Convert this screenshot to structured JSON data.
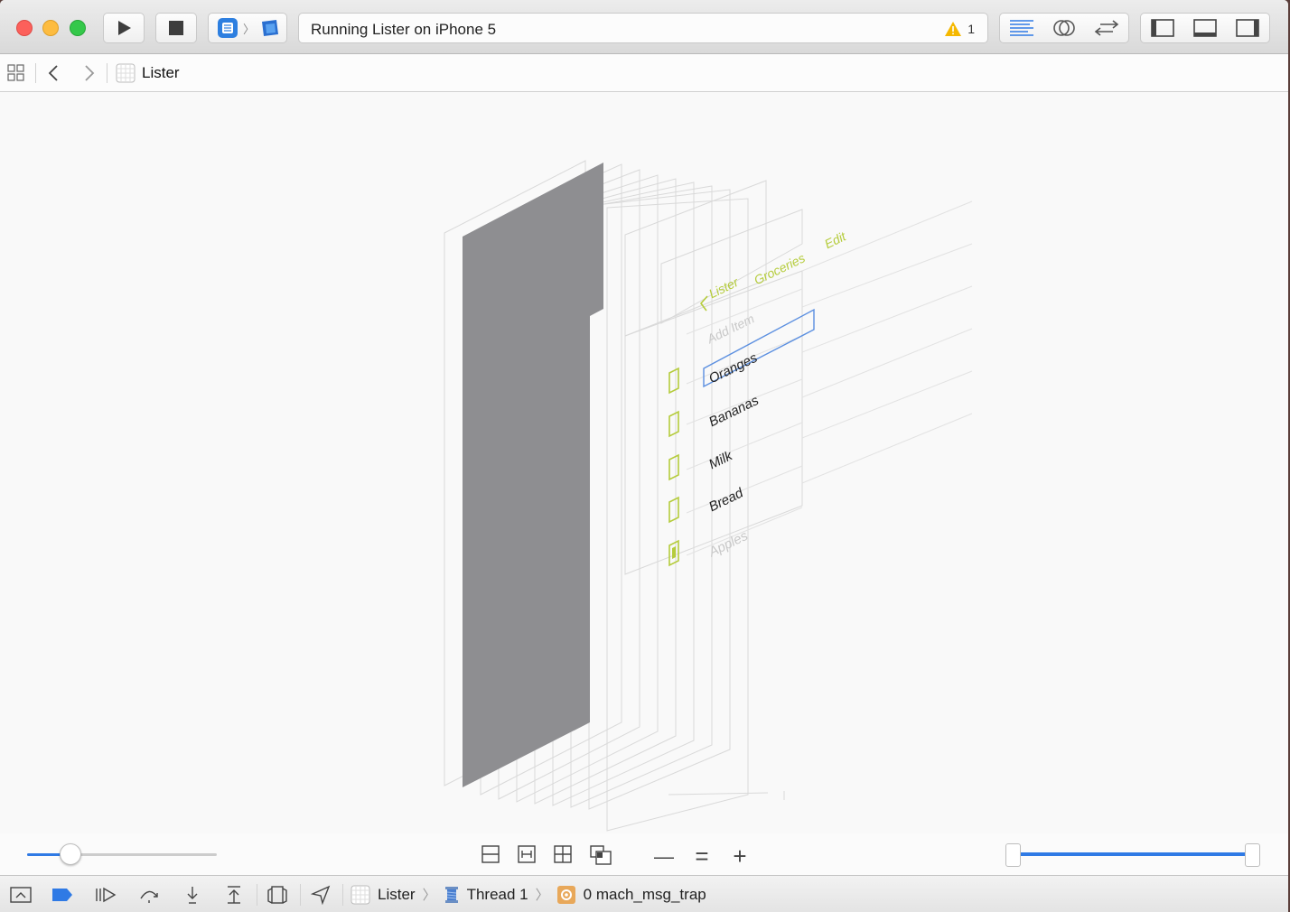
{
  "window": {
    "traffic_lights": {
      "close": "#fc605b",
      "minimize": "#fdbc40",
      "zoom": "#34c84a"
    },
    "activity": {
      "status_text": "Running Lister on iPhone 5",
      "warning_count": "1"
    }
  },
  "toolbar": {
    "run_icon": "play-icon",
    "stop_icon": "stop-icon",
    "scheme_icon": "lister-app-icon",
    "device_icon": "iphone-device-icon",
    "editor_buttons": [
      "standard-editor-icon",
      "assistant-editor-icon",
      "version-editor-icon"
    ],
    "view_buttons": [
      "navigator-toggle-icon",
      "debug-area-toggle-icon",
      "utilities-toggle-icon"
    ]
  },
  "jumpbar": {
    "app_name": "Lister"
  },
  "view_debugger": {
    "nav_items": {
      "back": "Lister",
      "title": "Groceries",
      "edit": "Edit"
    },
    "add_item_placeholder": "Add Item",
    "items": [
      {
        "label": "Oranges",
        "done": false
      },
      {
        "label": "Bananas",
        "done": false
      },
      {
        "label": "Milk",
        "done": false
      },
      {
        "label": "Bread",
        "done": false
      },
      {
        "label": "Apples",
        "done": true
      }
    ],
    "accent": "#b5cc3c",
    "selection_color": "#5b8fe0"
  },
  "controls": {
    "spacing_slider_value": 0.1,
    "range_slider": {
      "low": 0.0,
      "high": 1.0
    },
    "zoom_out": "—",
    "zoom_reset": "=",
    "zoom_in": "+"
  },
  "debugbar": {
    "breadcrumb": {
      "app": "Lister",
      "thread": "Thread 1",
      "frame": "0 mach_msg_trap"
    }
  }
}
